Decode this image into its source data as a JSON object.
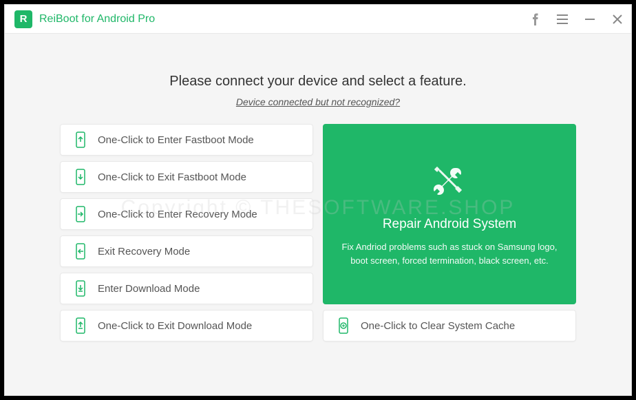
{
  "titlebar": {
    "logo_letter": "R",
    "title": "ReiBoot for Android Pro"
  },
  "heading": "Please connect your device and select a feature.",
  "sublink": "Device connected but not recognized?",
  "left_options": [
    {
      "label": "One-Click to Enter Fastboot Mode",
      "icon": "fastboot-up"
    },
    {
      "label": "One-Click to Exit Fastboot Mode",
      "icon": "fastboot-down"
    },
    {
      "label": "One-Click to Enter Recovery Mode",
      "icon": "recovery-in"
    },
    {
      "label": "Exit Recovery Mode",
      "icon": "recovery-out"
    },
    {
      "label": "Enter Download Mode",
      "icon": "download-in"
    },
    {
      "label": "One-Click to Exit Download Mode",
      "icon": "download-out"
    }
  ],
  "repair": {
    "title": "Repair Android System",
    "description": "Fix Andriod problems such as stuck on Samsung logo, boot screen, forced termination, black screen, etc."
  },
  "clear_cache": {
    "label": "One-Click to Clear System Cache"
  },
  "watermark": "Copyright © THESOFTWARE.SHOP",
  "colors": {
    "accent": "#1fb768"
  }
}
